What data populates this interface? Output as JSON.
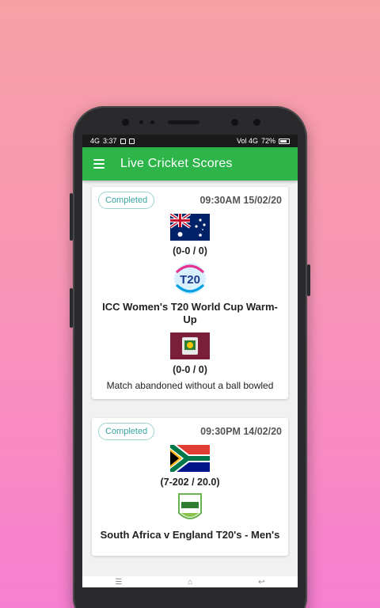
{
  "status_bar": {
    "network": "4G",
    "time": "3:37",
    "right_text": "Vol 4G",
    "battery": "72%"
  },
  "app_bar": {
    "title": "Live Cricket Scores",
    "menu_icon": "hamburger-icon"
  },
  "matches": [
    {
      "status": "Completed",
      "datetime": "09:30AM 15/02/20",
      "team1_flag": "australia-flag",
      "team1_score": "(0-0 / 0)",
      "series_logo": "t20-world-cup-logo",
      "series": "ICC Women's T20 World Cup Warm-Up",
      "team2_flag": "west-indies-flag",
      "team2_score": "(0-0 / 0)",
      "result": "Match abandoned without a ball bowled"
    },
    {
      "status": "Completed",
      "datetime": "09:30PM 14/02/20",
      "team1_flag": "south-africa-flag",
      "team1_score": "(7-202 / 20.0)",
      "series_logo": "international-series-logo",
      "series": "South Africa v England T20's - Men's"
    }
  ],
  "nav_bar": {
    "icons": [
      "menu-icon",
      "home-icon",
      "back-icon"
    ]
  },
  "colors": {
    "app_bar": "#2db54a",
    "badge": "#3aa4a0"
  }
}
